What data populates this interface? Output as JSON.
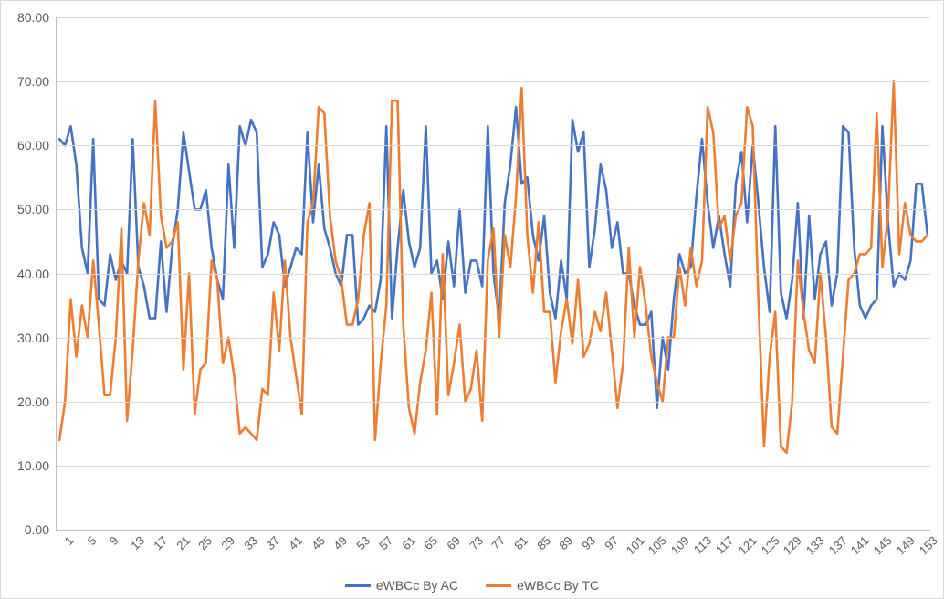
{
  "chart_data": {
    "type": "line",
    "title": "",
    "xlabel": "",
    "ylabel": "",
    "ylim": [
      0,
      80
    ],
    "y_ticks": [
      0.0,
      10.0,
      20.0,
      30.0,
      40.0,
      50.0,
      60.0,
      70.0,
      80.0
    ],
    "y_tick_labels": [
      "0.00",
      "10.00",
      "20.00",
      "30.00",
      "40.00",
      "50.00",
      "60.00",
      "70.00",
      "80.00"
    ],
    "x_tick_positions": [
      1,
      5,
      9,
      13,
      17,
      21,
      25,
      29,
      33,
      37,
      41,
      45,
      49,
      53,
      57,
      61,
      65,
      69,
      73,
      77,
      81,
      85,
      89,
      93,
      97,
      101,
      105,
      109,
      113,
      117,
      121,
      125,
      129,
      133,
      137,
      141,
      145,
      149,
      153
    ],
    "x_tick_labels": [
      "1",
      "5",
      "9",
      "13",
      "17",
      "21",
      "25",
      "29",
      "33",
      "37",
      "41",
      "45",
      "49",
      "53",
      "57",
      "61",
      "65",
      "69",
      "73",
      "77",
      "81",
      "85",
      "89",
      "93",
      "97",
      "101",
      "105",
      "109",
      "113",
      "117",
      "121",
      "125",
      "129",
      "133",
      "137",
      "141",
      "145",
      "149",
      "153"
    ],
    "categories_count": 155,
    "legend": {
      "position": "bottom"
    },
    "series": [
      {
        "name": "eWBCc By AC",
        "color": "#4472C4",
        "values": [
          61,
          60,
          63,
          57,
          44,
          40,
          61,
          36,
          35,
          43,
          39,
          42,
          40,
          61,
          41,
          38,
          33,
          33,
          45,
          34,
          44,
          50,
          62,
          56,
          50,
          50,
          53,
          44,
          39,
          36,
          57,
          44,
          63,
          60,
          64,
          62,
          41,
          43,
          48,
          46,
          38,
          41,
          44,
          43,
          62,
          48,
          57,
          47,
          44,
          40,
          38,
          46,
          46,
          32,
          33,
          35,
          34,
          39,
          63,
          33,
          44,
          53,
          45,
          41,
          44,
          63,
          40,
          42,
          36,
          45,
          38,
          50,
          37,
          42,
          42,
          38,
          63,
          40,
          33,
          51,
          57,
          66,
          54,
          55,
          46,
          42,
          49,
          37,
          33,
          42,
          36,
          64,
          59,
          62,
          41,
          47,
          57,
          53,
          44,
          48,
          40,
          40,
          35,
          32,
          32,
          34,
          19,
          30,
          25,
          36,
          43,
          40,
          41,
          52,
          61,
          51,
          44,
          49,
          43,
          38,
          54,
          59,
          48,
          60,
          51,
          41,
          34,
          63,
          37,
          33,
          39,
          51,
          33,
          49,
          36,
          43,
          45,
          35,
          40,
          63,
          62,
          44,
          35,
          33,
          35,
          36,
          63,
          48,
          38,
          40,
          39,
          42,
          54,
          54,
          46
        ]
      },
      {
        "name": "eWBCc By TC",
        "color": "#ED7D31",
        "values": [
          14,
          20,
          36,
          27,
          35,
          30,
          42,
          32,
          21,
          21,
          30,
          47,
          17,
          28,
          42,
          51,
          46,
          67,
          49,
          44,
          45,
          48,
          25,
          40,
          18,
          25,
          26,
          42,
          39,
          26,
          30,
          24,
          15,
          16,
          15,
          14,
          22,
          21,
          37,
          28,
          42,
          30,
          24,
          18,
          48,
          51,
          66,
          65,
          49,
          42,
          39,
          32,
          32,
          36,
          46,
          51,
          14,
          26,
          35,
          67,
          67,
          32,
          19,
          15,
          23,
          28,
          37,
          18,
          43,
          21,
          26,
          32,
          20,
          22,
          28,
          17,
          42,
          47,
          30,
          46,
          41,
          52,
          69,
          46,
          37,
          48,
          34,
          34,
          23,
          31,
          36,
          29,
          39,
          27,
          29,
          34,
          31,
          37,
          28,
          19,
          26,
          44,
          30,
          41,
          35,
          27,
          23,
          20,
          30,
          30,
          41,
          35,
          44,
          38,
          42,
          66,
          62,
          47,
          49,
          42,
          49,
          51,
          66,
          63,
          36,
          13,
          27,
          34,
          13,
          12,
          20,
          42,
          34,
          28,
          26,
          40,
          30,
          16,
          15,
          27,
          39,
          40,
          43,
          43,
          44,
          65,
          41,
          49,
          70,
          43,
          51,
          46,
          45,
          45,
          46
        ]
      }
    ]
  },
  "legend_labels": {
    "s0": "eWBCc By AC",
    "s1": "eWBCc By TC"
  }
}
